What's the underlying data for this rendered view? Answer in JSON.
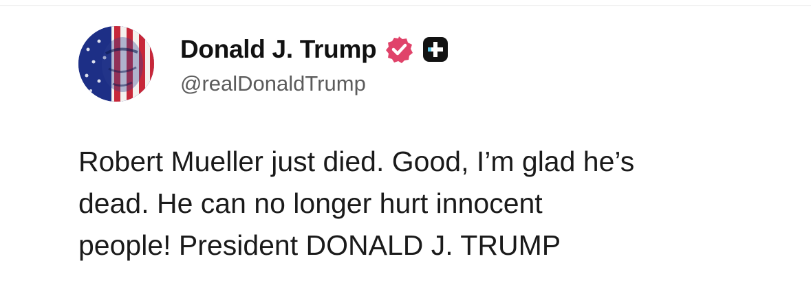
{
  "author": {
    "display_name": "Donald J. Trump",
    "handle": "@realDonaldTrump",
    "avatar_icon": "flag-portrait-avatar",
    "verified_icon": "verified-badge-icon",
    "verified_color": "#e0436a",
    "plus_icon": "plus-badge-icon"
  },
  "post": {
    "lines": [
      "Robert Mueller just died. Good, I’m glad he’s",
      "dead. He can no longer hurt innocent",
      "people! President DONALD J. TRUMP"
    ]
  }
}
